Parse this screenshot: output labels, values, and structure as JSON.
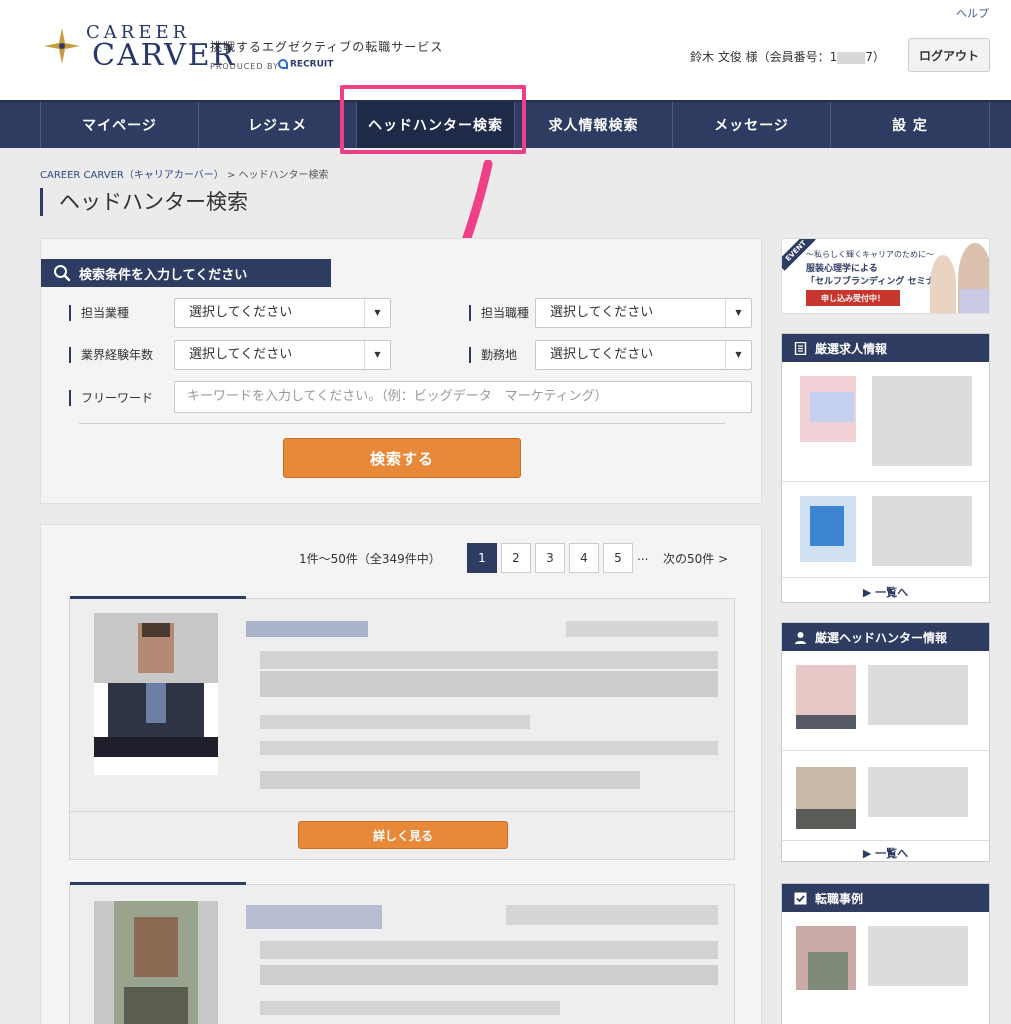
{
  "header": {
    "help": "ヘルプ",
    "brand_top": "CAREER",
    "brand_main": "CARVER",
    "tagline": "挑戦するエグゼクティブの転職サービス",
    "produced_by": "PRODUCED BY",
    "recruit": "RECRUIT",
    "user_prefix": "鈴木 文俊 様（会員番号：1",
    "user_suffix": "7）",
    "logout": "ログアウト"
  },
  "nav": {
    "items": [
      {
        "label": "マイページ"
      },
      {
        "label": "レジュメ"
      },
      {
        "label": "ヘッドハンター検索"
      },
      {
        "label": "求人情報検索"
      },
      {
        "label": "メッセージ"
      },
      {
        "label": "設 定"
      }
    ],
    "active_index": 2
  },
  "breadcrumb": {
    "home": "CAREER CARVER（キャリアカーバー）",
    "sep": " > ",
    "current": "ヘッドハンター検索"
  },
  "page_title": "ヘッドハンター検索",
  "search": {
    "header": "検索条件を入力してください",
    "field_industry": "担当業種",
    "field_job_type": "担当職種",
    "field_experience": "業界経験年数",
    "field_location": "勤務地",
    "field_keyword": "フリーワード",
    "select_placeholder": "選択してください",
    "keyword_placeholder": "キーワードを入力してください。（例：ビッグデータ　マーケティング）",
    "submit": "検索する"
  },
  "results": {
    "count": "1件〜50件（全349件中）",
    "pages": [
      "1",
      "2",
      "3",
      "4",
      "5"
    ],
    "current_page": "1",
    "ellipsis": "...",
    "next": "次の50件 >",
    "detail_button": "詳しく見る"
  },
  "sidebar": {
    "banner": {
      "tag": "EVENT",
      "line1": "〜私らしく輝くキャリアのために〜",
      "line2": "服装心理学による",
      "line3": "「セルフブランディング セミナー」",
      "cta": "申し込み受付中！"
    },
    "jobs_title": "厳選求人情報",
    "hunters_title": "厳選ヘッドハンター情報",
    "cases_title": "転職事例",
    "more": "▶ 一覧へ"
  },
  "colors": {
    "navy": "#2e3c62",
    "accent_orange": "#e8893a",
    "highlight_pink": "#ee3f87"
  }
}
